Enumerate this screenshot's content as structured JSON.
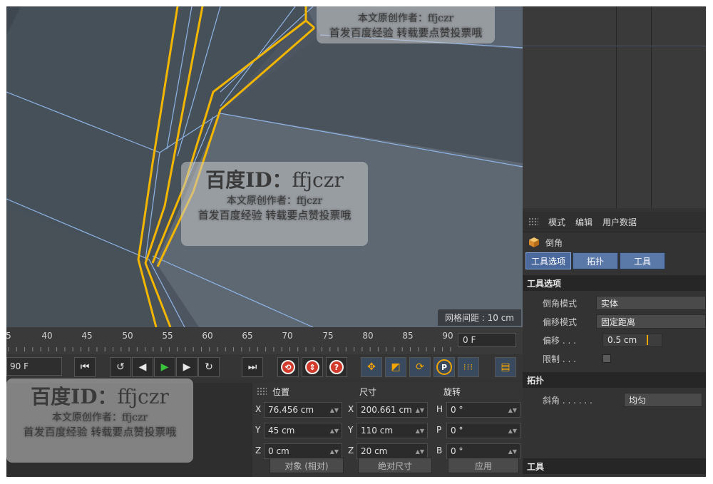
{
  "viewport": {
    "grid_spacing_label": "网格间距 : 10 cm"
  },
  "attributes": {
    "menu": [
      "模式",
      "编辑",
      "用户数据"
    ],
    "object_name": "倒角",
    "tabs": [
      "工具选项",
      "拓扑",
      "工具"
    ],
    "section_tool_options": "工具选项",
    "bevel_mode_label": "倒角模式",
    "bevel_mode_value": "实体",
    "offset_mode_label": "偏移模式",
    "offset_mode_value": "固定距离",
    "offset_label": "偏移 . . .",
    "offset_value": "0.5 cm",
    "limit_label": "限制 . . .",
    "section_topology": "拓扑",
    "miter_label": "斜角 . . . . . .",
    "miter_value": "均匀",
    "section_tool": "工具"
  },
  "timeline": {
    "ticks": [
      "5",
      "40",
      "45",
      "50",
      "55",
      "60",
      "65",
      "70",
      "75",
      "80",
      "85",
      "90"
    ],
    "current_frame": "0 F",
    "end_frame": "90 F"
  },
  "coordinates": {
    "header_position": "位置",
    "header_size": "尺寸",
    "header_rotation": "旋转",
    "rows": [
      {
        "axis": "X",
        "pos": "76.456 cm",
        "size_axis": "X",
        "size": "200.661 cm",
        "rot_axis": "H",
        "rot": "0 °"
      },
      {
        "axis": "Y",
        "pos": "45 cm",
        "size_axis": "Y",
        "size": "110 cm",
        "rot_axis": "P",
        "rot": "0 °"
      },
      {
        "axis": "Z",
        "pos": "0 cm",
        "size_axis": "Z",
        "size": "20 cm",
        "rot_axis": "B",
        "rot": "0 °"
      }
    ],
    "object_mode_btn": "对象 (相对)",
    "size_mode_btn": "绝对尺寸",
    "apply_btn": "应用"
  },
  "watermark": {
    "title": "百度ID：",
    "id": "ffjczr",
    "line2": "本文原创作者：ffjczr",
    "line3": "首发百度经验 转载要点赞投票哦"
  },
  "colors": {
    "viewport_bg": "#4c5560",
    "edge_highlight": "#f2b600",
    "edge_wire": "#8fb4e6",
    "tab_blue": "#5a78a8"
  }
}
